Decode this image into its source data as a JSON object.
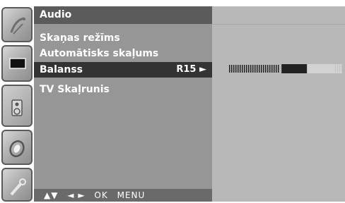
{
  "menu": {
    "title": "Audio",
    "items": [
      {
        "label": "Skaņas režīms",
        "value": ""
      },
      {
        "label": "Automātisks skaļums",
        "value": ""
      },
      {
        "label": "Balanss",
        "value": "R15 ►"
      },
      {
        "label": "TV Skaļrunis",
        "value": ""
      }
    ],
    "selected_index": 2
  },
  "bottom_bar": {
    "updown": "▲▼",
    "leftright": "◄ ►",
    "ok": "OK",
    "menu": "MENU"
  },
  "balance": {
    "value": 15,
    "label": "R15"
  },
  "sidebar": {
    "icons": [
      "satellite-dish-icon",
      "screen-icon",
      "speaker-icon",
      "clock-icon",
      "settings-wrench-icon"
    ],
    "active_index": 2
  },
  "colors": {
    "panel": "#969696",
    "title_bar": "#5b5b5b",
    "selected_row": "#333333",
    "right_panel": "#b8b8b8"
  }
}
